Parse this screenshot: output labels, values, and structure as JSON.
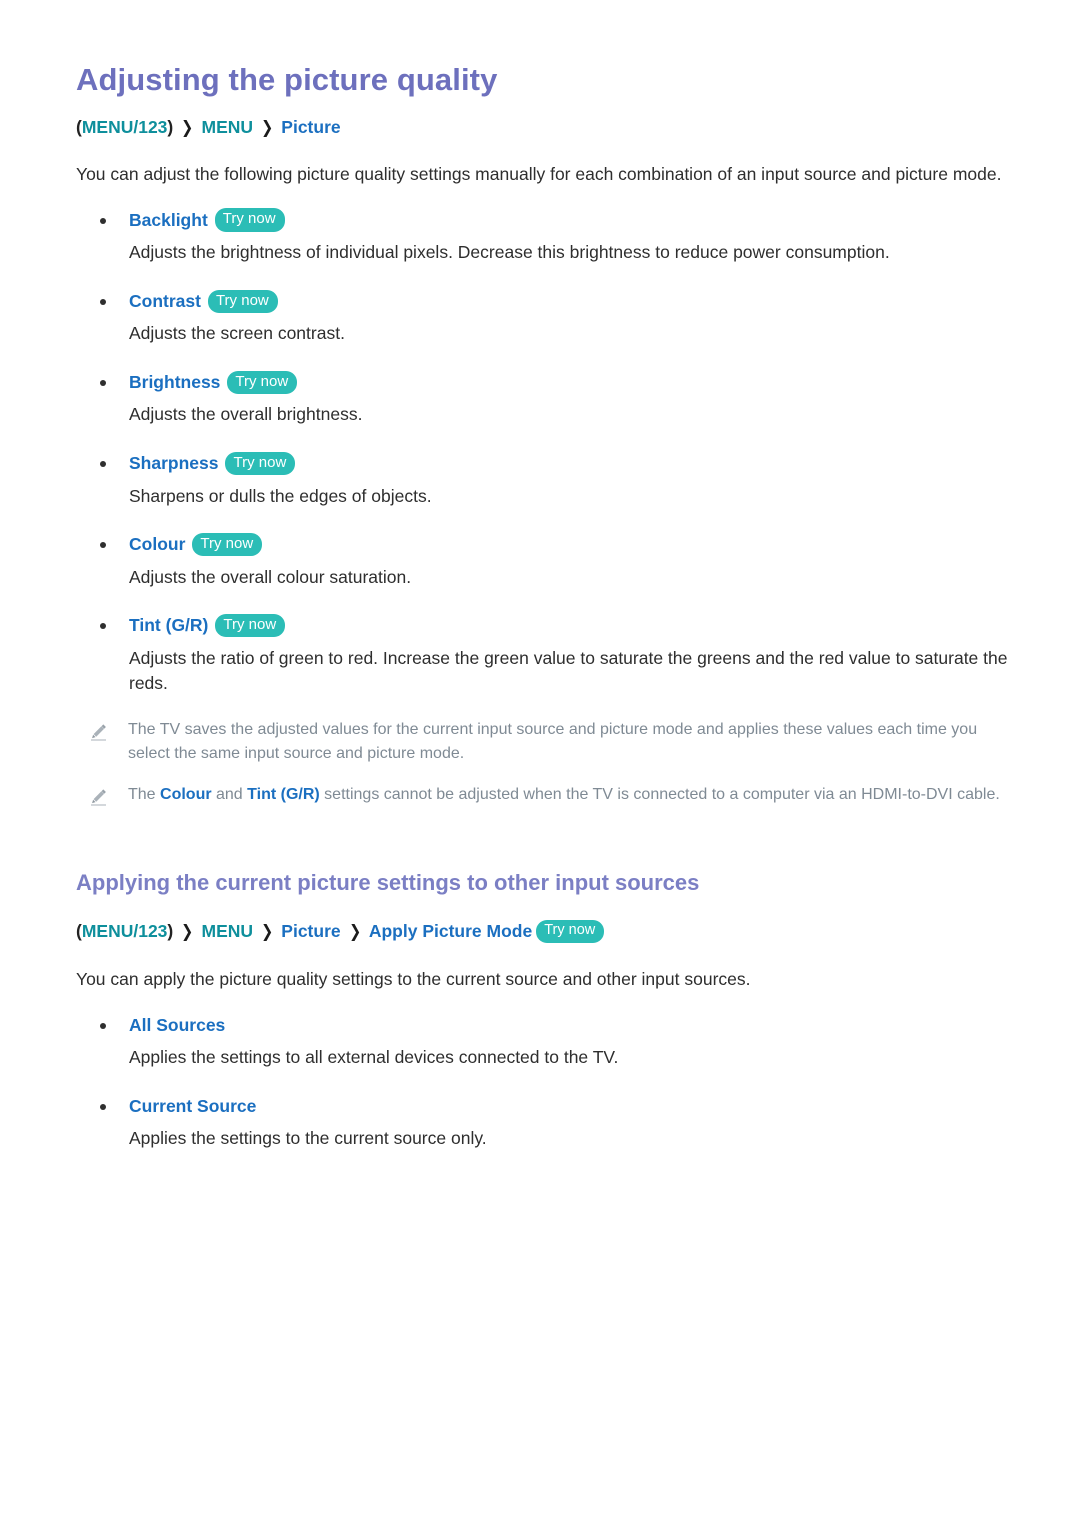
{
  "colors": {
    "title": "#6d70bd",
    "section_title": "#7b7fc4",
    "breadcrumb_menu": "#0e8f9c",
    "breadcrumb_page": "#1b6fc0",
    "link_blue": "#1b6fc0",
    "try_now_badge": "#2bbdb6",
    "body_text": "#2e2e2e",
    "note_text": "#7f8a94"
  },
  "section1": {
    "title": "Adjusting the picture quality",
    "breadcrumb": {
      "open_paren": "(",
      "menu123": "MENU/123",
      "close_paren": ")",
      "separator": "❯",
      "menu": "MENU",
      "page": "Picture"
    },
    "intro": "You can adjust the following picture quality settings manually for each combination of an input source and picture mode.",
    "items": [
      {
        "label": "Backlight",
        "badge": "Try now",
        "description": "Adjusts the brightness of individual pixels. Decrease this brightness to reduce power consumption."
      },
      {
        "label": "Contrast",
        "badge": "Try now",
        "description": "Adjusts the screen contrast."
      },
      {
        "label": "Brightness",
        "badge": "Try now",
        "description": "Adjusts the overall brightness."
      },
      {
        "label": "Sharpness",
        "badge": "Try now",
        "description": "Sharpens or dulls the edges of objects."
      },
      {
        "label": "Colour",
        "badge": "Try now",
        "description": "Adjusts the overall colour saturation."
      },
      {
        "label": "Tint (G/R)",
        "badge": "Try now",
        "description": "Adjusts the ratio of green to red. Increase the green value to saturate the greens and the red value to saturate the reds."
      }
    ],
    "notes": [
      {
        "icon": "pencil-icon",
        "parts": [
          {
            "text": "The TV saves the adjusted values for the current input source and picture mode and applies these values each time you select the same input source and picture mode.",
            "style": "normal"
          }
        ]
      },
      {
        "icon": "pencil-icon",
        "parts": [
          {
            "text": "The ",
            "style": "normal"
          },
          {
            "text": "Colour",
            "style": "highlight"
          },
          {
            "text": " and ",
            "style": "normal"
          },
          {
            "text": "Tint (G/R)",
            "style": "highlight"
          },
          {
            "text": " settings cannot be adjusted when the TV is connected to a computer via an HDMI-to-DVI cable.",
            "style": "normal"
          }
        ]
      }
    ]
  },
  "section2": {
    "title": "Applying the current picture settings to other input sources",
    "breadcrumb": {
      "open_paren": "(",
      "menu123": "MENU/123",
      "close_paren": ")",
      "separator": "❯",
      "menu": "MENU",
      "page": "Picture",
      "page2": "Apply Picture Mode",
      "badge": "Try now"
    },
    "intro": "You can apply the picture quality settings to the current source and other input sources.",
    "items": [
      {
        "label": "All Sources",
        "badge": "",
        "description": "Applies the settings to all external devices connected to the TV."
      },
      {
        "label": "Current Source",
        "badge": "",
        "description": "Applies the settings to the current source only."
      }
    ]
  }
}
